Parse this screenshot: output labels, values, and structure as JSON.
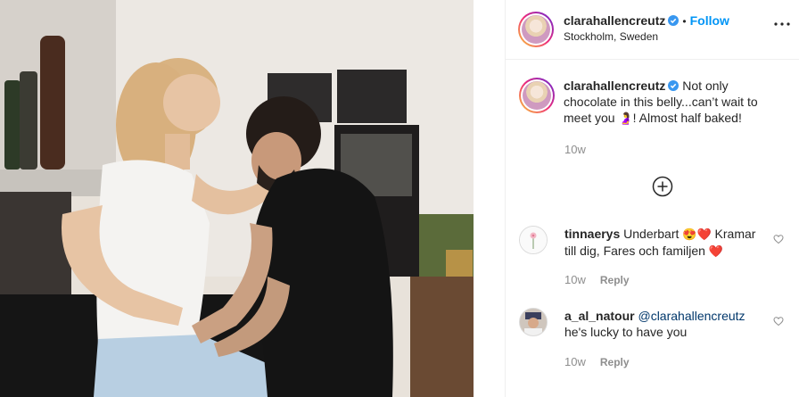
{
  "post": {
    "author": "clarahallencreutz",
    "follow_label": "Follow",
    "dot": "•",
    "location": "Stockholm, Sweden"
  },
  "caption": {
    "username": "clarahallencreutz",
    "text_part1": "Not only chocolate in this belly...can’t wait to meet you ",
    "emoji": "🤰",
    "text_part2": "! Almost half baked!",
    "time": "10w"
  },
  "comments": [
    {
      "username": "tinnaerys",
      "text_part1": "Underbart ",
      "emoji1": "😍❤️",
      "text_part2": " Kramar till dig, Fares och familjen ",
      "emoji2": "❤️",
      "time": "10w",
      "reply_label": "Reply"
    },
    {
      "username": "a_al_natour",
      "mention": "@clarahallencreutz",
      "text": "he's lucky to have you",
      "time": "10w",
      "reply_label": "Reply"
    }
  ],
  "colors": {
    "accent": "#0095f6",
    "verified": "#3897f0",
    "muted": "#8e8e8e",
    "heart_comment_2": "#ed4956"
  },
  "icons": [
    "verified-badge-icon",
    "more-options-icon",
    "load-more-plus-icon",
    "heart-outline-icon"
  ]
}
